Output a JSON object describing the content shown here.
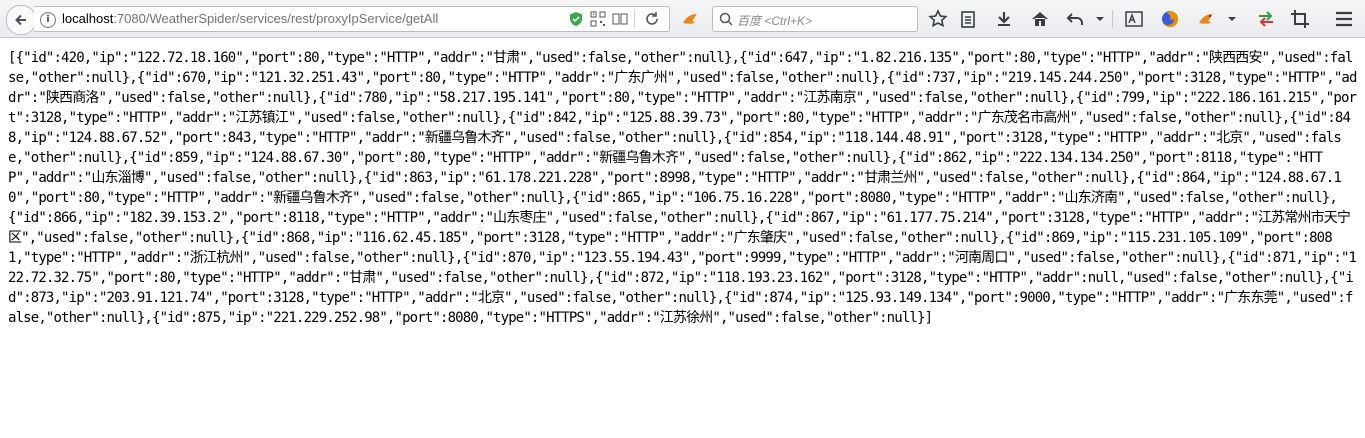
{
  "browser": {
    "url_host": "localhost",
    "url_rest": ":7080/WeatherSpider/services/rest/proxyIpService/getAll",
    "search_placeholder": "百度 <Ctrl+K>"
  },
  "page": {
    "body_text": "[{\"id\":420,\"ip\":\"122.72.18.160\",\"port\":80,\"type\":\"HTTP\",\"addr\":\"甘肃\",\"used\":false,\"other\":null},{\"id\":647,\"ip\":\"1.82.216.135\",\"port\":80,\"type\":\"HTTP\",\"addr\":\"陕西西安\",\"used\":false,\"other\":null},{\"id\":670,\"ip\":\"121.32.251.43\",\"port\":80,\"type\":\"HTTP\",\"addr\":\"广东广州\",\"used\":false,\"other\":null},{\"id\":737,\"ip\":\"219.145.244.250\",\"port\":3128,\"type\":\"HTTP\",\"addr\":\"陕西商洛\",\"used\":false,\"other\":null},{\"id\":780,\"ip\":\"58.217.195.141\",\"port\":80,\"type\":\"HTTP\",\"addr\":\"江苏南京\",\"used\":false,\"other\":null},{\"id\":799,\"ip\":\"222.186.161.215\",\"port\":3128,\"type\":\"HTTP\",\"addr\":\"江苏镇江\",\"used\":false,\"other\":null},{\"id\":842,\"ip\":\"125.88.39.73\",\"port\":80,\"type\":\"HTTP\",\"addr\":\"广东茂名市高州\",\"used\":false,\"other\":null},{\"id\":848,\"ip\":\"124.88.67.52\",\"port\":843,\"type\":\"HTTP\",\"addr\":\"新疆乌鲁木齐\",\"used\":false,\"other\":null},{\"id\":854,\"ip\":\"118.144.48.91\",\"port\":3128,\"type\":\"HTTP\",\"addr\":\"北京\",\"used\":false,\"other\":null},{\"id\":859,\"ip\":\"124.88.67.30\",\"port\":80,\"type\":\"HTTP\",\"addr\":\"新疆乌鲁木齐\",\"used\":false,\"other\":null},{\"id\":862,\"ip\":\"222.134.134.250\",\"port\":8118,\"type\":\"HTTP\",\"addr\":\"山东淄博\",\"used\":false,\"other\":null},{\"id\":863,\"ip\":\"61.178.221.228\",\"port\":8998,\"type\":\"HTTP\",\"addr\":\"甘肃兰州\",\"used\":false,\"other\":null},{\"id\":864,\"ip\":\"124.88.67.10\",\"port\":80,\"type\":\"HTTP\",\"addr\":\"新疆乌鲁木齐\",\"used\":false,\"other\":null},{\"id\":865,\"ip\":\"106.75.16.228\",\"port\":8080,\"type\":\"HTTP\",\"addr\":\"山东济南\",\"used\":false,\"other\":null},{\"id\":866,\"ip\":\"182.39.153.2\",\"port\":8118,\"type\":\"HTTP\",\"addr\":\"山东枣庄\",\"used\":false,\"other\":null},{\"id\":867,\"ip\":\"61.177.75.214\",\"port\":3128,\"type\":\"HTTP\",\"addr\":\"江苏常州市天宁区\",\"used\":false,\"other\":null},{\"id\":868,\"ip\":\"116.62.45.185\",\"port\":3128,\"type\":\"HTTP\",\"addr\":\"广东肇庆\",\"used\":false,\"other\":null},{\"id\":869,\"ip\":\"115.231.105.109\",\"port\":8081,\"type\":\"HTTP\",\"addr\":\"浙江杭州\",\"used\":false,\"other\":null},{\"id\":870,\"ip\":\"123.55.194.43\",\"port\":9999,\"type\":\"HTTP\",\"addr\":\"河南周口\",\"used\":false,\"other\":null},{\"id\":871,\"ip\":\"122.72.32.75\",\"port\":80,\"type\":\"HTTP\",\"addr\":\"甘肃\",\"used\":false,\"other\":null},{\"id\":872,\"ip\":\"118.193.23.162\",\"port\":3128,\"type\":\"HTTP\",\"addr\":null,\"used\":false,\"other\":null},{\"id\":873,\"ip\":\"203.91.121.74\",\"port\":3128,\"type\":\"HTTP\",\"addr\":\"北京\",\"used\":false,\"other\":null},{\"id\":874,\"ip\":\"125.93.149.134\",\"port\":9000,\"type\":\"HTTP\",\"addr\":\"广东东莞\",\"used\":false,\"other\":null},{\"id\":875,\"ip\":\"221.229.252.98\",\"port\":8080,\"type\":\"HTTPS\",\"addr\":\"江苏徐州\",\"used\":false,\"other\":null}]"
  }
}
